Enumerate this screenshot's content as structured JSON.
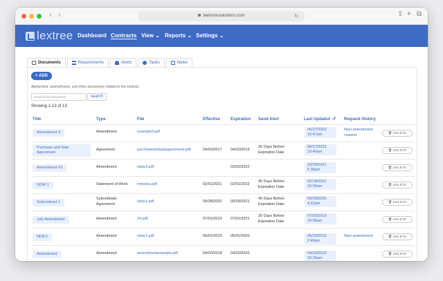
{
  "browser": {
    "url": "berkmansolutions.com"
  },
  "app": {
    "logo_text": "lextree",
    "nav": [
      {
        "label": "Dashboard"
      },
      {
        "label": "Contracts"
      },
      {
        "label": "View ⌄"
      },
      {
        "label": "Reports ⌄"
      },
      {
        "label": "Settings ⌄"
      }
    ]
  },
  "tabs": [
    {
      "label": "Documents"
    },
    {
      "label": "Requirements"
    },
    {
      "label": "Alerts"
    },
    {
      "label": "Tasks"
    },
    {
      "label": "Notes"
    }
  ],
  "panel": {
    "add_label": "+ ADD",
    "description": "Agreement, amendments, and other documents related to the contract",
    "search_placeholder": "search by keyword",
    "search_button": "search",
    "showing": "Showing 1-13 of 13"
  },
  "table": {
    "headers": [
      "Title",
      "Type",
      "File",
      "Effective",
      "Expiration",
      "Send Alert",
      "Last Updated ↓F",
      "Request History"
    ],
    "delete_label": "🗑 DELETE",
    "rows": [
      {
        "title": "Amendment 3",
        "type": "Amendment",
        "file": "example3.pdf",
        "effective": "",
        "expiration": "",
        "alert": "",
        "updated": "06/27/2023 10:47am",
        "history": "New amendment request"
      },
      {
        "title": "Purchase and Sale Agreement",
        "type": "Agreement",
        "file": "purchaseandsaleagreement.pdf",
        "effective": "04/20/2017",
        "expiration": "04/20/2019",
        "alert": "30 Days Before Expiration Date",
        "updated": "06/27/2023 10:46am",
        "history": ""
      },
      {
        "title": "Amendment #2",
        "type": "Amendment",
        "file": "ndav3.pdf",
        "effective": "",
        "expiration": "03/02/2022",
        "alert": "",
        "updated": "10/28/2021 5:36pm",
        "history": ""
      },
      {
        "title": "SOW 1",
        "type": "Statement of Work",
        "file": "minutes.pdf",
        "effective": "02/01/2021",
        "expiration": "02/01/2022",
        "alert": "45 Days Before Expiration Date",
        "updated": "02/18/2021 10:59am",
        "history": ""
      },
      {
        "title": "Subcontract 1",
        "type": "Subordinate Agreement",
        "file": "ndav1.pdf",
        "effective": "09/28/2020",
        "expiration": "09/28/2021",
        "alert": "45 Days Before Expiration Date",
        "updated": "09/28/2020 4:22pm",
        "history": ""
      },
      {
        "title": "July Amendment",
        "type": "Amendment",
        "file": "24.pdf",
        "effective": "07/01/2019",
        "expiration": "07/01/2021",
        "alert": "30 Days Before Expiration Date",
        "updated": "07/30/2019 10:56am",
        "history": ""
      },
      {
        "title": "NDA 2",
        "type": "Amendment",
        "file": "ndav1.pdf",
        "effective": "05/01/2019",
        "expiration": "05/01/2020",
        "alert": "",
        "updated": "05/29/2019 2:49pm",
        "history": "New amendment"
      },
      {
        "title": "Amendment",
        "type": "Amendment",
        "file": "amendmentexample.pdf",
        "effective": "04/20/2018",
        "expiration": "04/20/2020",
        "alert": "",
        "updated": "04/03/2019 10:36am",
        "history": ""
      }
    ]
  },
  "colors": {
    "brand": "#3d6ac3",
    "pill_bg": "#e9f0fc"
  }
}
